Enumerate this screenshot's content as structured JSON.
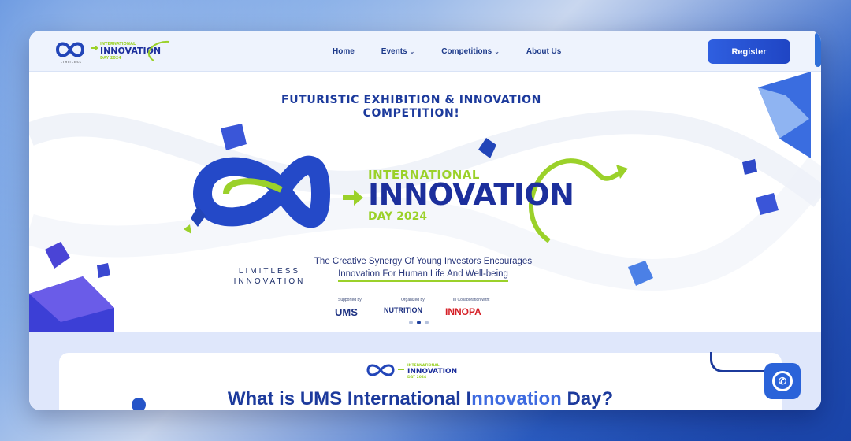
{
  "nav": {
    "links": [
      {
        "label": "Home",
        "dropdown": false
      },
      {
        "label": "Events",
        "dropdown": true
      },
      {
        "label": "Competitions",
        "dropdown": true
      },
      {
        "label": "About Us",
        "dropdown": false
      }
    ],
    "register_label": "Register",
    "logo": {
      "brand": "LIMITLESS INNOVATION",
      "event_line1": "INTERNATIONAL",
      "event_line2": "INNOVATION",
      "event_line3": "DAY 2024"
    }
  },
  "hero": {
    "title": "FUTURISTIC EXHIBITION & INNOVATION COMPETITION!",
    "brand_line1": "LIMITLESS",
    "brand_line2": "INNOVATION",
    "event_line1": "INTERNATIONAL",
    "event_line2": "INNOVATION",
    "event_line3": "DAY 2024",
    "tagline_line1": "The Creative Synergy Of Young Investors Encourages",
    "tagline_line2": "Innovation For Human Life And Well-being",
    "supported_label": "Supported by:",
    "organized_label": "Organized by:",
    "collab_label": "In Collaboration with:",
    "sponsor_ums": "UMS",
    "sponsor_nutrition": "NUTRITION",
    "sponsor_innopa": "INNOPA",
    "carousel": {
      "count": 3,
      "active": 2
    }
  },
  "section": {
    "heading_part1": "What is UMS International I",
    "heading_accent": "nnovation",
    "heading_part2": " Day?"
  },
  "colors": {
    "primary": "#1c3a9c",
    "accent_green": "#9bd12a",
    "button": "#2f5fe0"
  },
  "icons": {
    "whatsapp": "whatsapp-icon",
    "chevron": "chevron-down-icon"
  }
}
